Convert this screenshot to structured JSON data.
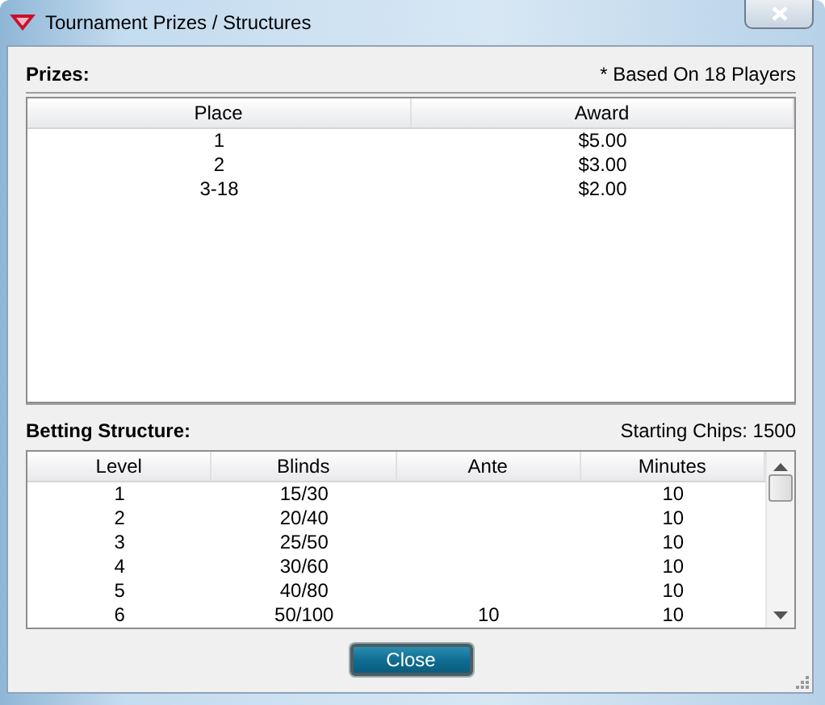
{
  "window": {
    "title": "Tournament Prizes / Structures"
  },
  "prizes": {
    "label": "Prizes:",
    "note": "* Based On 18 Players",
    "columns": [
      "Place",
      "Award"
    ],
    "rows": [
      {
        "place": "1",
        "award": "$5.00"
      },
      {
        "place": "2",
        "award": "$3.00"
      },
      {
        "place": "3-18",
        "award": "$2.00"
      }
    ]
  },
  "betting_structure": {
    "label": "Betting Structure:",
    "note": "Starting Chips: 1500",
    "columns": [
      "Level",
      "Blinds",
      "Ante",
      "Minutes"
    ],
    "rows": [
      {
        "level": "1",
        "blinds": "15/30",
        "minutes": "10"
      },
      {
        "level": "2",
        "blinds": "20/40",
        "minutes": "10"
      },
      {
        "level": "3",
        "blinds": "25/50",
        "minutes": "10"
      },
      {
        "level": "4",
        "blinds": "30/60",
        "minutes": "10"
      },
      {
        "level": "5",
        "blinds": "40/80",
        "minutes": "10"
      },
      {
        "level": "6",
        "blinds": "50/100",
        "ante": "10",
        "minutes": "10"
      }
    ]
  },
  "buttons": [
    {
      "label": "Close"
    }
  ]
}
